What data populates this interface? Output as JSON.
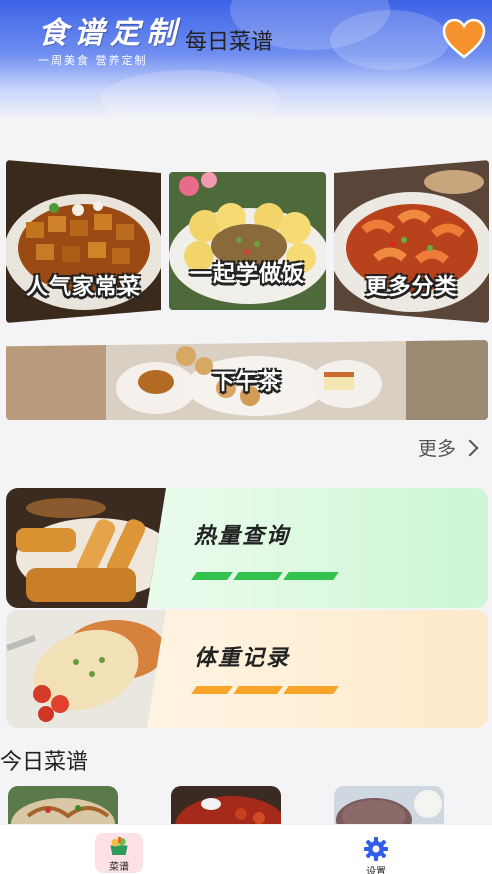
{
  "header": {
    "brand_title": "食谱定制",
    "brand_subtitle": "一周美食 营养定制",
    "page_title": "每日菜谱"
  },
  "categories": [
    {
      "label": "人气家常菜",
      "icon": "stir-fried-tofu-photo"
    },
    {
      "label": "一起学做饭",
      "icon": "corn-buns-photo"
    },
    {
      "label": "更多分类",
      "icon": "spicy-shrimp-photo"
    },
    {
      "label": "下午茶",
      "icon": "afternoon-tea-photo"
    }
  ],
  "more_label": "更多",
  "features": [
    {
      "title": "热量查询",
      "icon": "fried-shrimp-photo"
    },
    {
      "title": "体重记录",
      "icon": "chicken-rice-photo"
    }
  ],
  "today_section_title": "今日菜谱",
  "nav": {
    "recipes_label": "菜谱",
    "settings_label": "设置"
  },
  "colors": {
    "header_blue": "#3d63e6",
    "heart_orange": "#f6922e",
    "calorie_green": "#33c24b",
    "weight_orange": "#f7a428",
    "settings_blue": "#2f5de6"
  }
}
